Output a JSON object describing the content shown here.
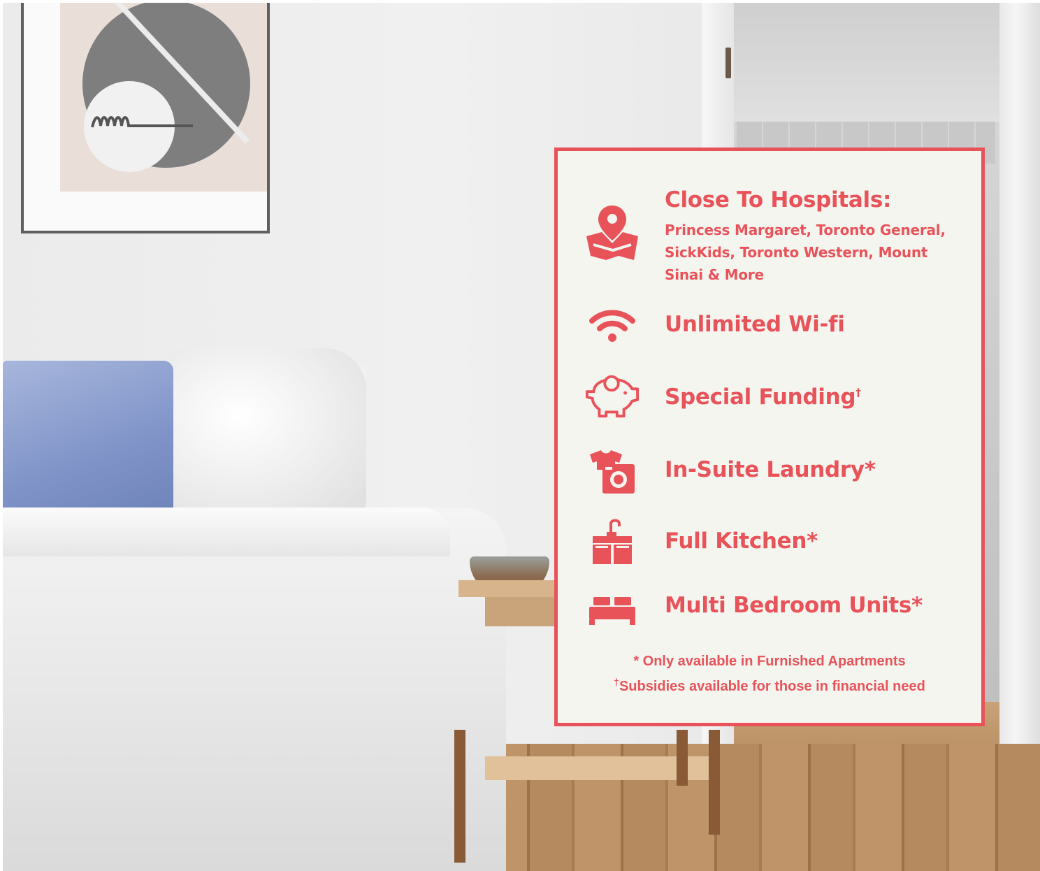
{
  "card": {
    "accent_color": "#e8535a",
    "background_color": "#f5f5f0",
    "features": [
      {
        "icon": "map-pin-icon",
        "title": "Close To Hospitals:",
        "detail": "Princess Margaret, Toronto General, SickKids, Toronto Western, Mount Sinai & More"
      },
      {
        "icon": "wifi-icon",
        "title": "Unlimited Wi-fi"
      },
      {
        "icon": "piggy-bank-icon",
        "title": "Special Funding",
        "title_mark": "†"
      },
      {
        "icon": "laundry-icon",
        "title": "In-Suite Laundry*"
      },
      {
        "icon": "kitchen-sink-icon",
        "title": "Full Kitchen*"
      },
      {
        "icon": "bed-icon",
        "title": "Multi Bedroom Units*"
      }
    ],
    "footnotes": [
      {
        "mark": "",
        "text": "* Only available in Furnished Apartments"
      },
      {
        "mark": "†",
        "text": "Subsidies available for those in financial need"
      }
    ]
  }
}
